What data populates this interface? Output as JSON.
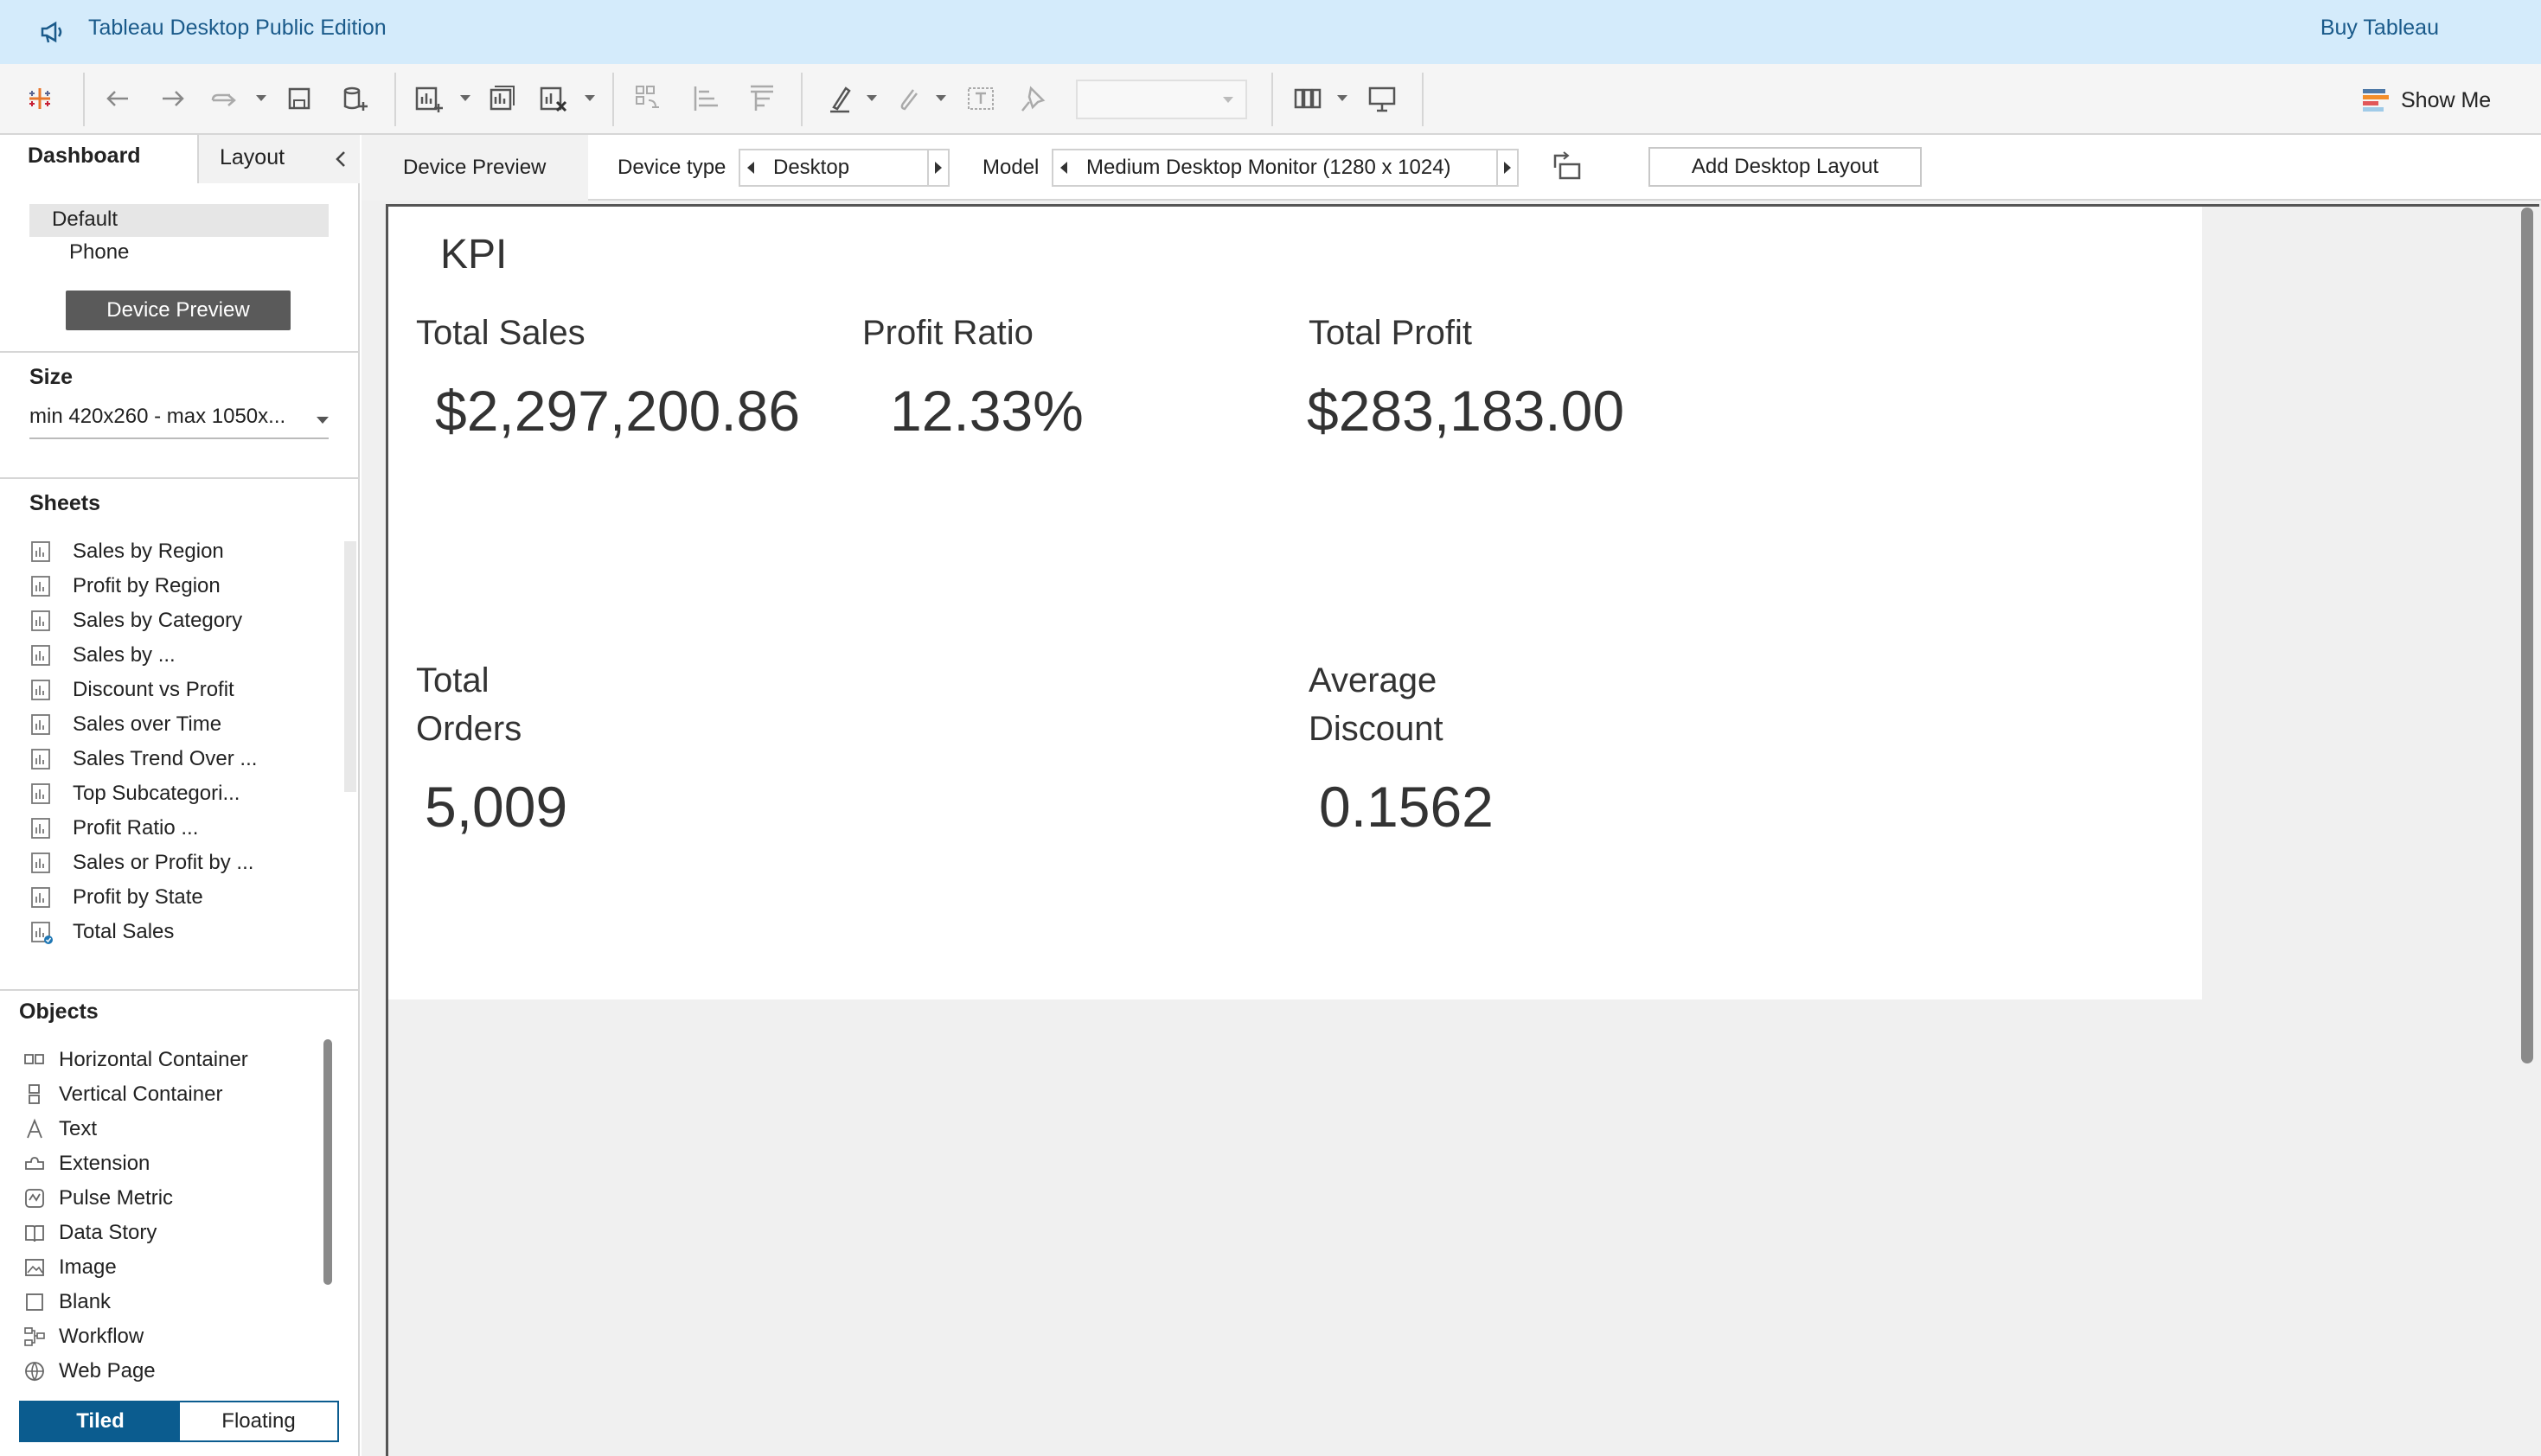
{
  "banner": {
    "title": "Tableau Desktop Public Edition",
    "buy_label": "Buy Tableau"
  },
  "toolbar": {
    "show_me_label": "Show Me"
  },
  "left_panel": {
    "tabs": {
      "dashboard": "Dashboard",
      "layout": "Layout"
    },
    "layouts": [
      {
        "label": "Default",
        "selected": true
      },
      {
        "label": "Phone",
        "selected": false
      }
    ],
    "device_preview_button": "Device Preview",
    "size": {
      "title": "Size",
      "value": "min 420x260 - max 1050x..."
    },
    "sheets": {
      "title": "Sheets",
      "items": [
        "Sales by Region",
        "Profit by Region",
        "Sales by Category",
        "Sales by ...",
        "Discount vs Profit",
        "Sales over Time",
        "Sales Trend Over ...",
        "Top Subcategori...",
        "Profit Ratio ...",
        "Sales or Profit by ...",
        "Profit by State",
        "Total Sales"
      ]
    },
    "objects": {
      "title": "Objects",
      "items": [
        {
          "label": "Horizontal Container",
          "icon": "horizontal-container-icon"
        },
        {
          "label": "Vertical Container",
          "icon": "vertical-container-icon"
        },
        {
          "label": "Text",
          "icon": "text-icon"
        },
        {
          "label": "Extension",
          "icon": "extension-icon"
        },
        {
          "label": "Pulse Metric",
          "icon": "pulse-metric-icon"
        },
        {
          "label": "Data Story",
          "icon": "data-story-icon"
        },
        {
          "label": "Image",
          "icon": "image-icon"
        },
        {
          "label": "Blank",
          "icon": "blank-icon"
        },
        {
          "label": "Workflow",
          "icon": "workflow-icon"
        },
        {
          "label": "Web Page",
          "icon": "web-page-icon"
        }
      ]
    },
    "tiled_label": "Tiled",
    "floating_label": "Floating"
  },
  "preview_bar": {
    "tab_label": "Device Preview",
    "device_type_label": "Device type",
    "device_type_value": "Desktop",
    "model_label": "Model",
    "model_value": "Medium Desktop Monitor (1280 x 1024)",
    "add_layout_label": "Add Desktop Layout"
  },
  "dashboard": {
    "title": "KPI",
    "kpis": [
      {
        "label": "Total Sales",
        "value": "$2,297,200.86"
      },
      {
        "label": "Profit Ratio",
        "value": "12.33%"
      },
      {
        "label": "Total Profit",
        "value": "$283,183.00"
      },
      {
        "label": "Total\nOrders",
        "value": "5,009"
      },
      {
        "label": "Average\nDiscount",
        "value": "0.1562"
      }
    ]
  },
  "colors": {
    "banner_bg": "#d4ebfb",
    "banner_text": "#1a5a8a",
    "accent": "#0b5c8f",
    "button_dark": "#5a5a5a"
  }
}
